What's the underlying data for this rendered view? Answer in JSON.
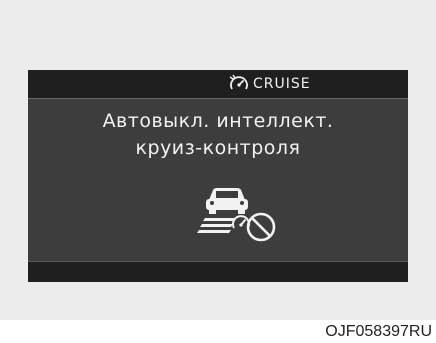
{
  "display": {
    "header": {
      "icon": "cruise-gauge-icon",
      "label": "CRUISE"
    },
    "message_lines": [
      "Автовыкл. интеллект.",
      "круиз-контроля"
    ],
    "graphic": "smart-cruise-disabled-icon"
  },
  "figure_code": "OJF058397RU",
  "colors": {
    "background": "#ececec",
    "screen": "#3d3d3d",
    "bars": "#1f1f1f",
    "text": "#f2f2f2"
  }
}
